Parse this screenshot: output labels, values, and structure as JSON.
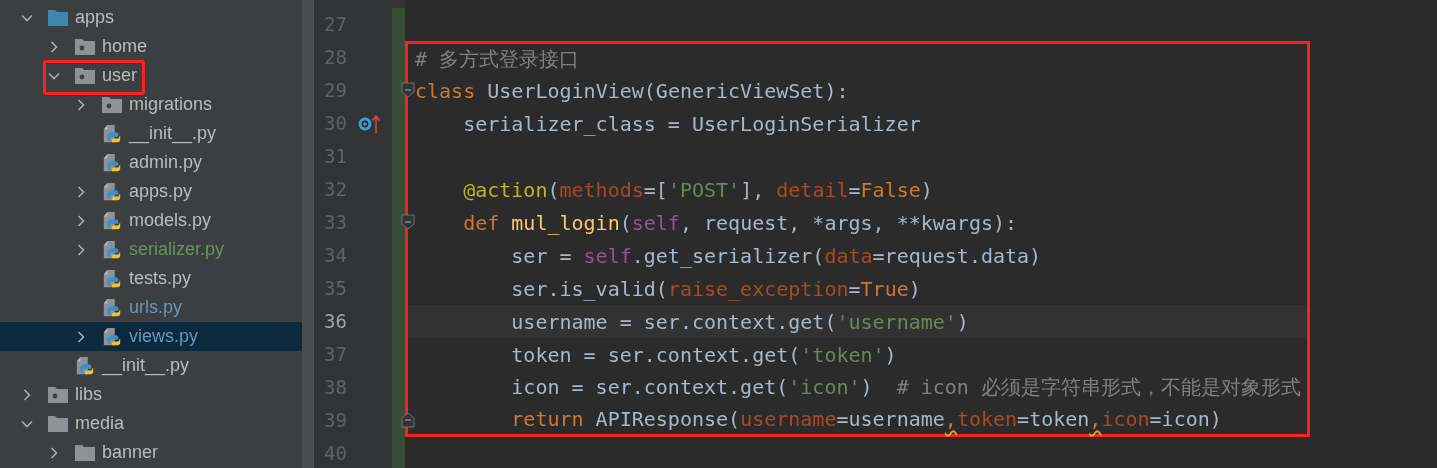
{
  "project_tree": [
    {
      "label": "apps",
      "kind": "source-folder",
      "expanded": true,
      "selected": false,
      "boxed": false,
      "children": [
        {
          "label": "home",
          "kind": "package",
          "expanded": false,
          "selected": false,
          "boxed": false
        },
        {
          "label": "user",
          "kind": "package",
          "expanded": true,
          "selected": false,
          "boxed": true,
          "children": [
            {
              "label": "migrations",
              "kind": "package",
              "expanded": false,
              "selected": false,
              "boxed": false
            },
            {
              "label": "__init__.py",
              "kind": "python-file",
              "selected": false,
              "boxed": false
            },
            {
              "label": "admin.py",
              "kind": "python-file",
              "selected": false,
              "boxed": false
            },
            {
              "label": "apps.py",
              "kind": "python-file",
              "expanded": false,
              "selected": false,
              "boxed": false
            },
            {
              "label": "models.py",
              "kind": "python-file",
              "expanded": false,
              "selected": false,
              "boxed": false
            },
            {
              "label": "serializer.py",
              "kind": "python-file",
              "expanded": false,
              "selected": false,
              "boxed": false,
              "color": "#629755"
            },
            {
              "label": "tests.py",
              "kind": "python-file",
              "selected": false,
              "boxed": false
            },
            {
              "label": "urls.py",
              "kind": "python-file",
              "selected": false,
              "boxed": false,
              "color": "#6897bb"
            },
            {
              "label": "views.py",
              "kind": "python-file",
              "expanded": false,
              "selected": true,
              "boxed": false,
              "color": "#6897bb"
            }
          ]
        },
        {
          "label": "__init__.py",
          "kind": "python-file",
          "selected": false,
          "boxed": false
        }
      ]
    },
    {
      "label": "libs",
      "kind": "package",
      "expanded": false,
      "selected": false,
      "boxed": false
    },
    {
      "label": "media",
      "kind": "folder",
      "expanded": true,
      "selected": false,
      "boxed": false,
      "children": [
        {
          "label": "banner",
          "kind": "folder",
          "expanded": false,
          "selected": false,
          "boxed": false
        }
      ]
    }
  ],
  "editor": {
    "lines": [
      {
        "number": "27",
        "kind": "plain",
        "current": false,
        "changed": true,
        "boxed": false
      },
      {
        "number": "28",
        "kind": "plain",
        "current": false,
        "changed": true,
        "boxed": true,
        "tokens": [
          {
            "kind": "comment",
            "text": "# 多方式登录接口"
          }
        ]
      },
      {
        "number": "29",
        "kind": "fold-start",
        "current": false,
        "changed": true,
        "boxed": true,
        "tokens": [
          {
            "kind": "keyword",
            "text": "class"
          },
          {
            "kind": "plain",
            "text": " UserLoginView(GenericViewSet):"
          }
        ]
      },
      {
        "number": "30",
        "kind": "override",
        "current": false,
        "changed": true,
        "boxed": true,
        "tokens": [
          {
            "kind": "plain",
            "text": "    serializer_class = UserLoginSerializer"
          }
        ]
      },
      {
        "number": "31",
        "kind": "plain",
        "current": false,
        "changed": true,
        "boxed": true
      },
      {
        "number": "32",
        "kind": "plain",
        "current": false,
        "changed": true,
        "boxed": true,
        "tokens": [
          {
            "kind": "decorator",
            "text": "    @action"
          },
          {
            "kind": "plain",
            "text": "("
          },
          {
            "kind": "param",
            "text": "methods"
          },
          {
            "kind": "plain",
            "text": "=["
          },
          {
            "kind": "string",
            "text": "'POST'"
          },
          {
            "kind": "plain",
            "text": "], "
          },
          {
            "kind": "param",
            "text": "detail"
          },
          {
            "kind": "plain",
            "text": "="
          },
          {
            "kind": "keyword",
            "text": "False"
          },
          {
            "kind": "plain",
            "text": ")"
          }
        ]
      },
      {
        "number": "33",
        "kind": "fold-start",
        "current": false,
        "changed": true,
        "boxed": true,
        "tokens": [
          {
            "kind": "keyword",
            "text": "    def "
          },
          {
            "kind": "function",
            "text": "mul_login"
          },
          {
            "kind": "plain",
            "text": "("
          },
          {
            "kind": "self",
            "text": "self"
          },
          {
            "kind": "plain",
            "text": ", request, *args, **kwargs):"
          }
        ]
      },
      {
        "number": "34",
        "kind": "plain",
        "current": false,
        "changed": true,
        "boxed": true,
        "tokens": [
          {
            "kind": "plain",
            "text": "        ser = "
          },
          {
            "kind": "self",
            "text": "self"
          },
          {
            "kind": "plain",
            "text": ".get_serializer("
          },
          {
            "kind": "param",
            "text": "data"
          },
          {
            "kind": "plain",
            "text": "=request.data)"
          }
        ]
      },
      {
        "number": "35",
        "kind": "plain",
        "current": false,
        "changed": true,
        "boxed": true,
        "tokens": [
          {
            "kind": "plain",
            "text": "        ser.is_valid("
          },
          {
            "kind": "param",
            "text": "raise_exception"
          },
          {
            "kind": "plain",
            "text": "="
          },
          {
            "kind": "keyword",
            "text": "True"
          },
          {
            "kind": "plain",
            "text": ")"
          }
        ]
      },
      {
        "number": "36",
        "kind": "plain",
        "current": true,
        "changed": true,
        "boxed": true,
        "tokens": [
          {
            "kind": "plain",
            "text": "        username = ser.context.get("
          },
          {
            "kind": "string",
            "text": "'username'"
          },
          {
            "kind": "plain",
            "text": ")"
          }
        ]
      },
      {
        "number": "37",
        "kind": "plain",
        "current": false,
        "changed": true,
        "boxed": true,
        "tokens": [
          {
            "kind": "plain",
            "text": "        token = ser.context.get("
          },
          {
            "kind": "string",
            "text": "'token'"
          },
          {
            "kind": "plain",
            "text": ")"
          }
        ]
      },
      {
        "number": "38",
        "kind": "plain",
        "current": false,
        "changed": true,
        "boxed": true,
        "tokens": [
          {
            "kind": "plain",
            "text": "        icon = ser.context.get("
          },
          {
            "kind": "string",
            "text": "'icon'"
          },
          {
            "kind": "plain",
            "text": ")  "
          },
          {
            "kind": "comment",
            "text": "# icon 必须是字符串形式，不能是对象形式"
          }
        ]
      },
      {
        "number": "39",
        "kind": "fold-end",
        "current": false,
        "changed": true,
        "boxed": true,
        "tokens": [
          {
            "kind": "keyword",
            "text": "        return"
          },
          {
            "kind": "plain",
            "text": " APIResponse("
          },
          {
            "kind": "param",
            "text": "username"
          },
          {
            "kind": "plain",
            "text": "=username"
          },
          {
            "kind": "warning",
            "text": ","
          },
          {
            "kind": "param",
            "text": "token"
          },
          {
            "kind": "plain",
            "text": "=token"
          },
          {
            "kind": "warning",
            "text": ","
          },
          {
            "kind": "param",
            "text": "icon"
          },
          {
            "kind": "plain",
            "text": "=icon)"
          }
        ]
      },
      {
        "number": "40",
        "kind": "plain",
        "current": false,
        "changed": true,
        "boxed": false
      }
    ]
  }
}
